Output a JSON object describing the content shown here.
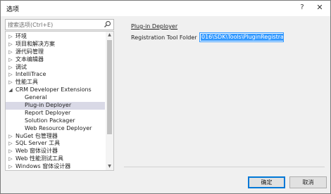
{
  "window": {
    "title": "选项",
    "help_glyph": "?",
    "close_glyph": "✕"
  },
  "search": {
    "placeholder": "搜索选项(Ctrl+E)"
  },
  "tree": {
    "items": [
      {
        "label": "环境",
        "level": 0,
        "expander": "collapsed"
      },
      {
        "label": "项目和解决方案",
        "level": 0,
        "expander": "collapsed"
      },
      {
        "label": "源代码管理",
        "level": 0,
        "expander": "collapsed"
      },
      {
        "label": "文本编辑器",
        "level": 0,
        "expander": "collapsed"
      },
      {
        "label": "调试",
        "level": 0,
        "expander": "collapsed"
      },
      {
        "label": "IntelliTrace",
        "level": 0,
        "expander": "collapsed"
      },
      {
        "label": "性能工具",
        "level": 0,
        "expander": "collapsed"
      },
      {
        "label": "CRM Developer Extensions",
        "level": 0,
        "expander": "expanded"
      },
      {
        "label": "General",
        "level": 1,
        "expander": "none"
      },
      {
        "label": "Plug-in Deployer",
        "level": 1,
        "expander": "none",
        "selected": true
      },
      {
        "label": "Report Deployer",
        "level": 1,
        "expander": "none"
      },
      {
        "label": "Solution Packager",
        "level": 1,
        "expander": "none"
      },
      {
        "label": "Web Resource Deployer",
        "level": 1,
        "expander": "none"
      },
      {
        "label": "NuGet 包管理器",
        "level": 0,
        "expander": "collapsed"
      },
      {
        "label": "SQL Server 工具",
        "level": 0,
        "expander": "collapsed"
      },
      {
        "label": "Web 窗体设计器",
        "level": 0,
        "expander": "collapsed"
      },
      {
        "label": "Web 性能测试工具",
        "level": 0,
        "expander": "collapsed"
      },
      {
        "label": "Windows 窗体设计器",
        "level": 0,
        "expander": "collapsed"
      }
    ],
    "scroll_position": 0.0
  },
  "panel": {
    "section_title": "Plug-in Deployer",
    "field_label": "Registration Tool Folder",
    "field_value": "016\\SDK\\Tools\\PluginRegistration\\"
  },
  "buttons": {
    "ok_label": "确定",
    "cancel_label": "取消"
  },
  "colors": {
    "selection": "#d9d9e6",
    "input_highlight": "#3399ff",
    "focus_border": "#0078d7"
  }
}
